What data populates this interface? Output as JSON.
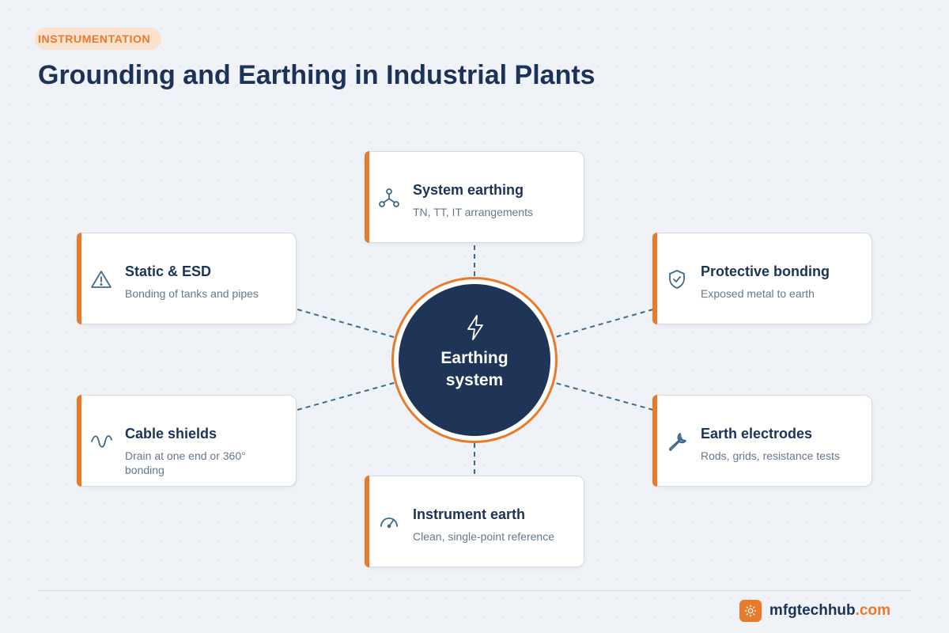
{
  "header": {
    "category": "INSTRUMENTATION",
    "title": "Grounding and Earthing in Industrial Plants"
  },
  "hub": {
    "icon": "lightning-bolt-icon",
    "label_line1": "Earthing",
    "label_line2": "system"
  },
  "nodes": [
    {
      "id": "system-earthing",
      "title": "System earthing",
      "description": "TN, TT, IT arrangements",
      "icon": "network-nodes-icon"
    },
    {
      "id": "protective-bonding",
      "title": "Protective bonding",
      "description": "Exposed metal to earth",
      "icon": "shield-check-icon"
    },
    {
      "id": "earth-electrodes",
      "title": "Earth electrodes",
      "description": "Rods, grids, resistance tests",
      "icon": "wrench-icon"
    },
    {
      "id": "instrument-earth",
      "title": "Instrument earth",
      "description": "Clean, single-point reference",
      "icon": "gauge-icon"
    },
    {
      "id": "cable-shields",
      "title": "Cable shields",
      "description": "Drain at one end or 360° bonding",
      "icon": "sine-wave-icon"
    },
    {
      "id": "static-esd",
      "title": "Static & ESD",
      "description": "Bonding of tanks and pipes",
      "icon": "warning-triangle-icon"
    }
  ],
  "footer": {
    "brand_icon": "gear-icon",
    "brand_name": "mfgtechhub",
    "brand_tld": ".com"
  },
  "colors": {
    "accent": "#e87b2b",
    "navy": "#1c3357",
    "hub_fill": "#1e3557",
    "connector": "#3f6a8c",
    "background": "#eff2f6"
  }
}
